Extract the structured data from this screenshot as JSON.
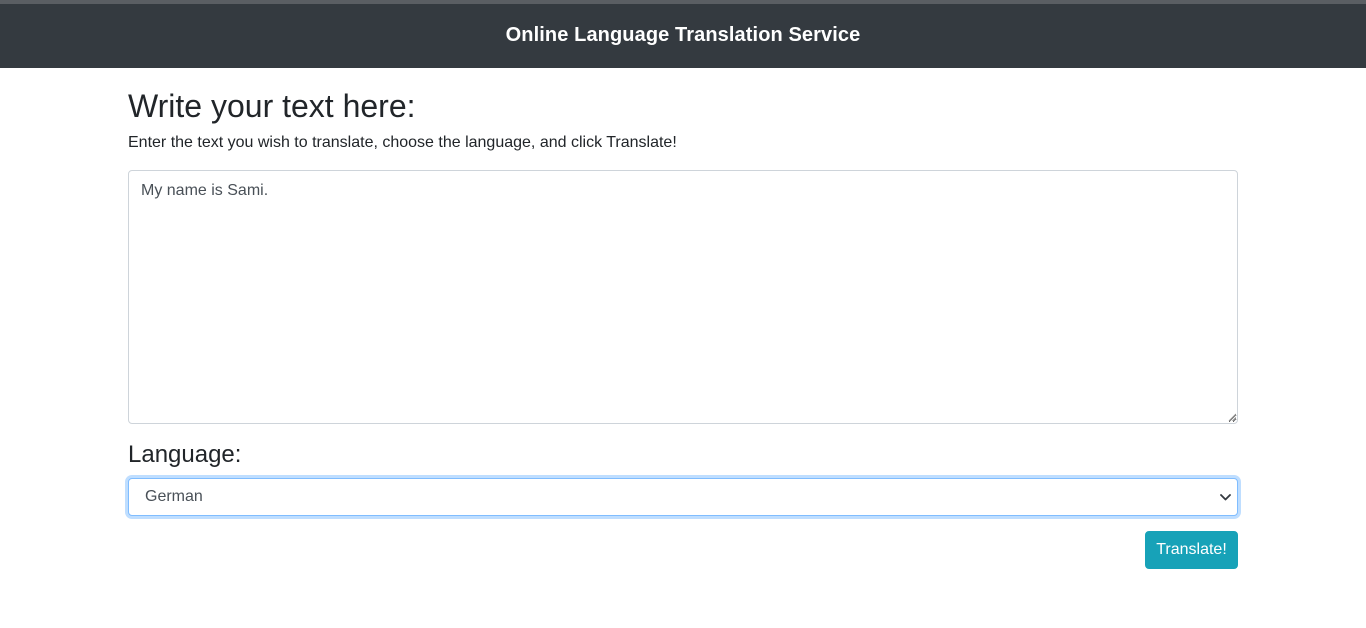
{
  "navbar": {
    "title": "Online Language Translation Service",
    "background": "#343a40"
  },
  "main": {
    "heading": "Write your text here:",
    "instructions": "Enter the text you wish to translate, choose the language, and click Translate!",
    "text_input": {
      "value": "My name is Sami."
    },
    "language_label": "Language:",
    "language_select": {
      "selected": "German",
      "icon": "chevron-down-icon"
    },
    "translate_button": {
      "label": "Translate!",
      "color": "#17a2b8"
    }
  }
}
